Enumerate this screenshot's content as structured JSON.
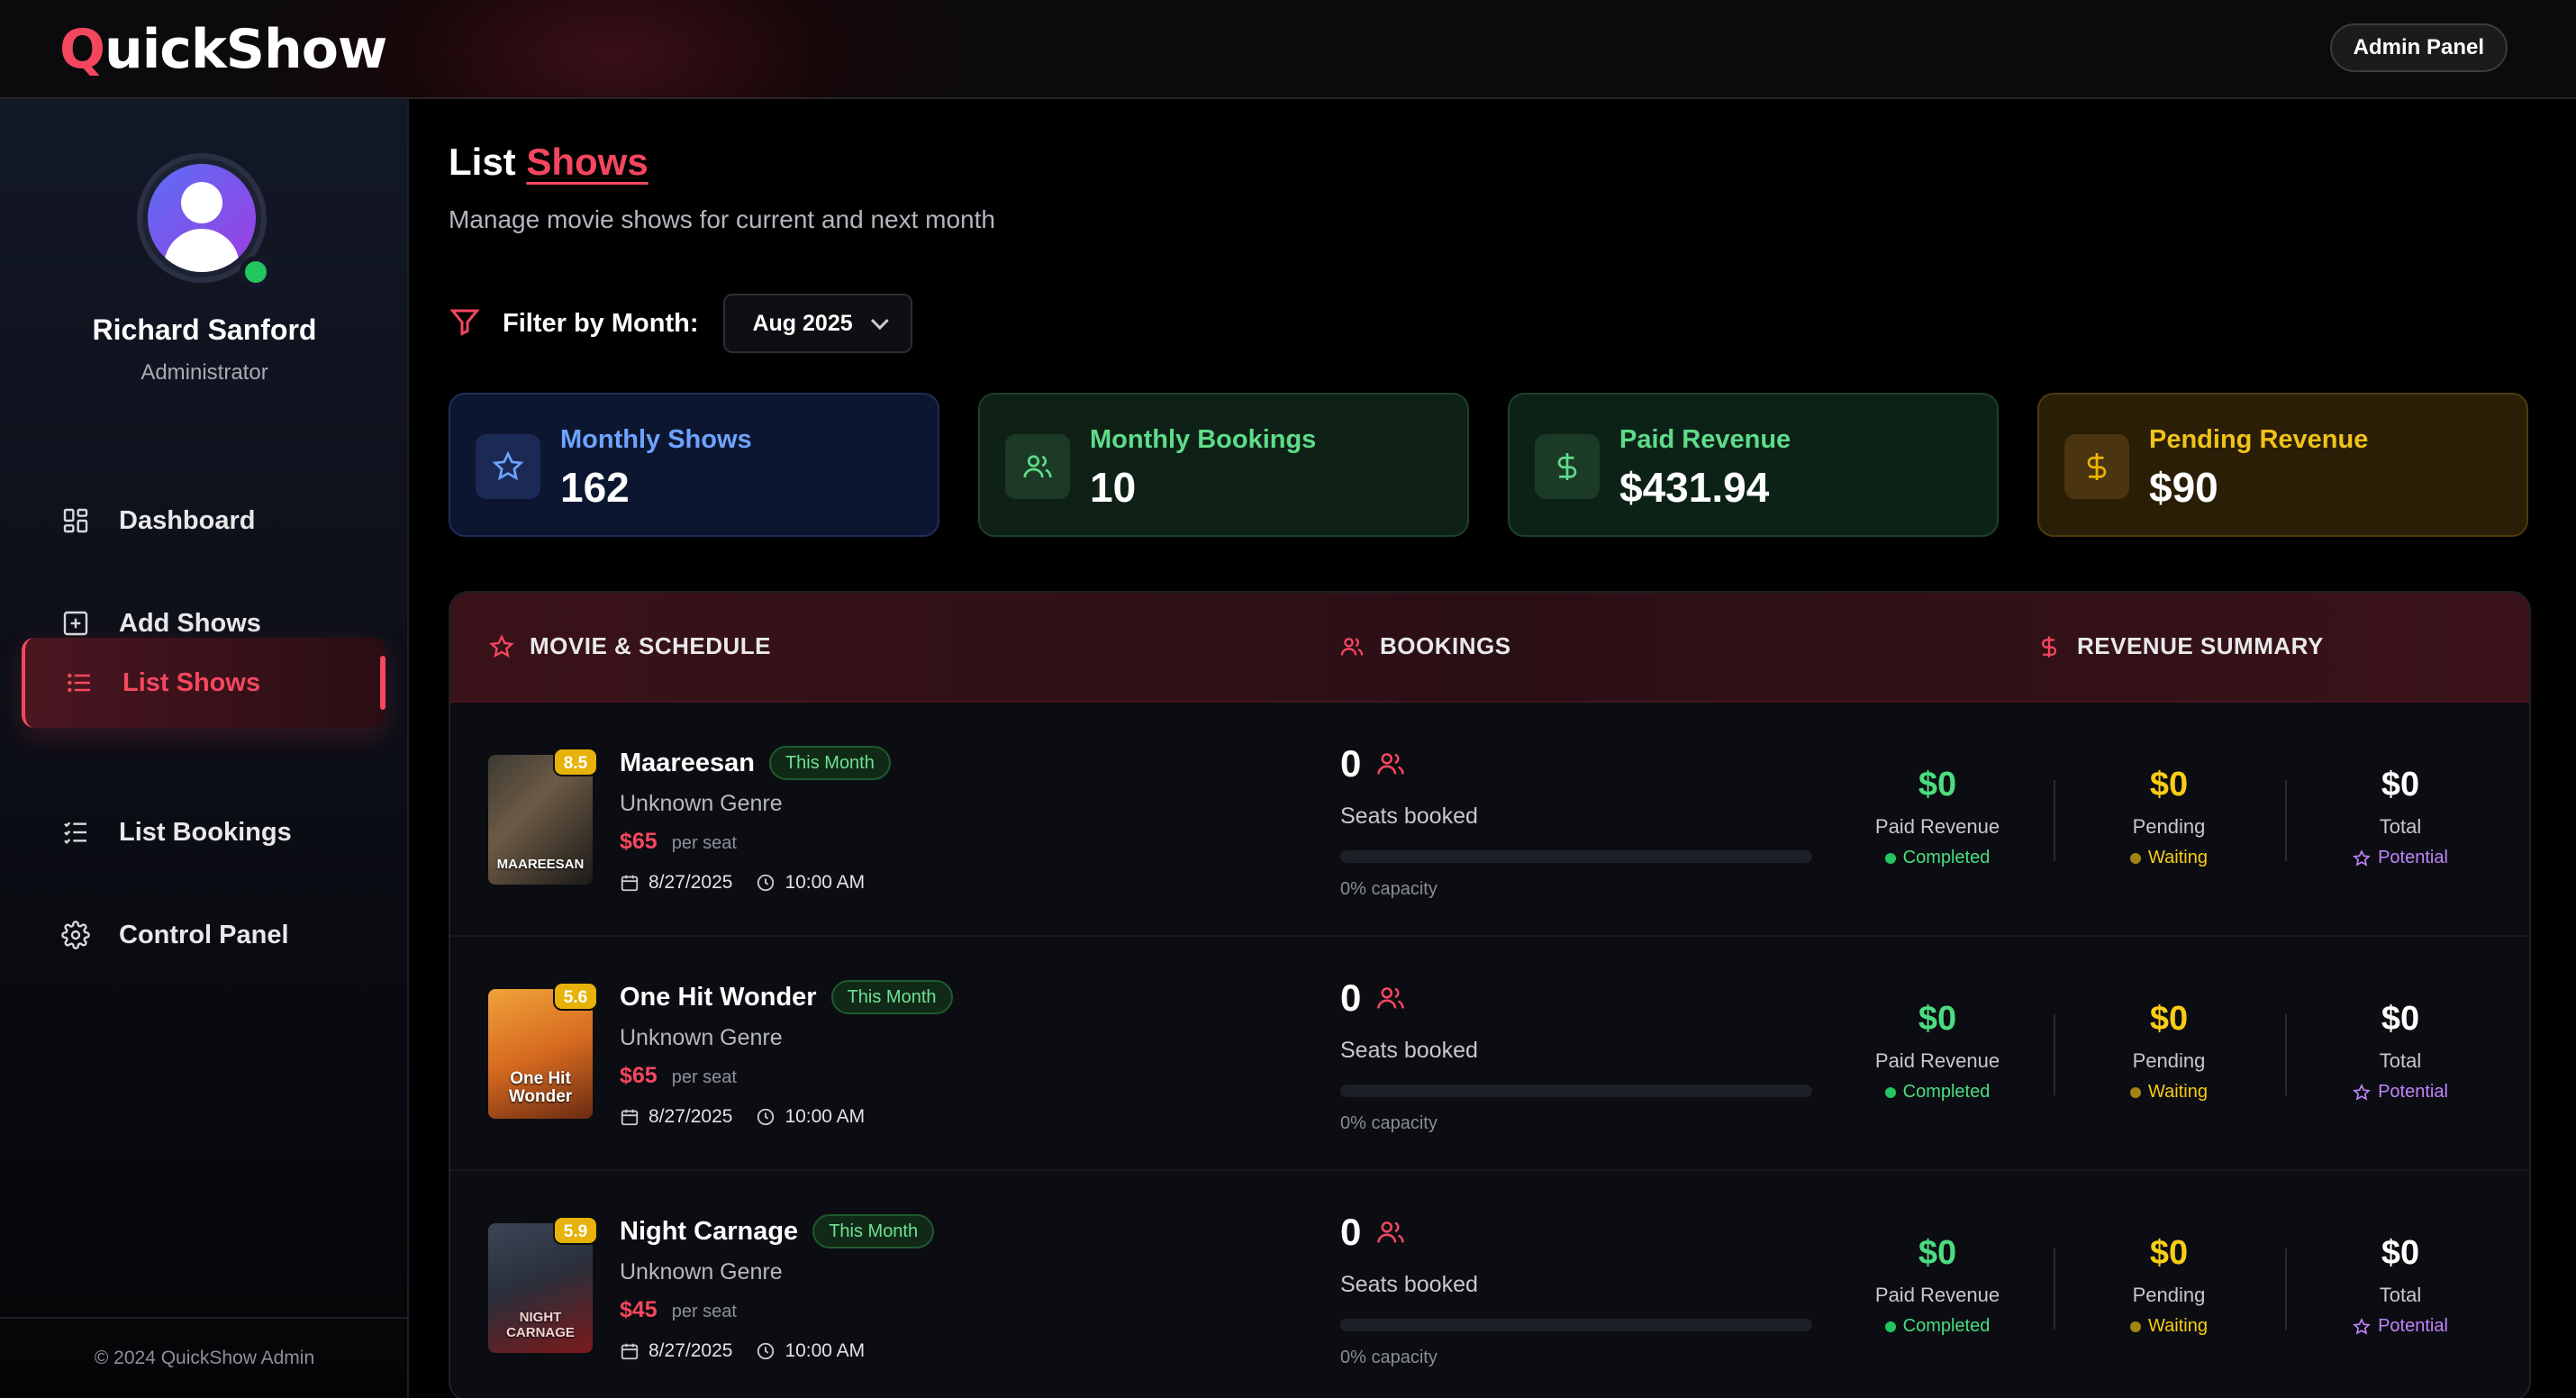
{
  "app": {
    "logo_first": "Q",
    "logo_rest": "uickShow",
    "admin_button": "Admin Panel"
  },
  "user": {
    "name": "Richard Sanford",
    "role": "Administrator"
  },
  "sidebar": {
    "items": [
      {
        "label": "Dashboard",
        "icon": "dashboard-grid-icon"
      },
      {
        "label": "Add Shows",
        "icon": "plus-square-icon"
      },
      {
        "label": "List Shows",
        "icon": "list-icon",
        "active": true
      },
      {
        "label": "List Bookings",
        "icon": "checklist-icon"
      },
      {
        "label": "Control Panel",
        "icon": "gear-icon"
      }
    ],
    "footer": "© 2024 QuickShow Admin"
  },
  "page": {
    "title_plain": "List",
    "title_accent": "Shows",
    "subtitle": "Manage movie shows for current and next month"
  },
  "filter": {
    "label": "Filter by Month:",
    "selected": "Aug 2025"
  },
  "stats": [
    {
      "label": "Monthly Shows",
      "value": "162",
      "icon": "star-icon"
    },
    {
      "label": "Monthly Bookings",
      "value": "10",
      "icon": "users-icon"
    },
    {
      "label": "Paid Revenue",
      "value": "$431.94",
      "icon": "dollar-icon"
    },
    {
      "label": "Pending Revenue",
      "value": "$90",
      "icon": "dollar-icon"
    }
  ],
  "table": {
    "headers": [
      "MOVIE & SCHEDULE",
      "BOOKINGS",
      "REVENUE SUMMARY"
    ],
    "rows": [
      {
        "title": "Maareesan",
        "badge": "This Month",
        "rating": "8.5",
        "poster_text": "MAAREESAN",
        "genre": "Unknown Genre",
        "price": "$65",
        "per": "per seat",
        "date": "8/27/2025",
        "time": "10:00 AM",
        "booked": "0",
        "booked_label": "Seats booked",
        "capacity": "0% capacity",
        "capacity_fraction": 0,
        "paid": "$0",
        "paid_label": "Paid Revenue",
        "paid_status": "Completed",
        "pending": "$0",
        "pending_label": "Pending",
        "pending_status": "Waiting",
        "total": "$0",
        "total_label": "Total",
        "total_status": "Potential"
      },
      {
        "title": "One Hit Wonder",
        "badge": "This Month",
        "rating": "5.6",
        "poster_text": "One Hit Wonder",
        "genre": "Unknown Genre",
        "price": "$65",
        "per": "per seat",
        "date": "8/27/2025",
        "time": "10:00 AM",
        "booked": "0",
        "booked_label": "Seats booked",
        "capacity": "0% capacity",
        "capacity_fraction": 0,
        "paid": "$0",
        "paid_label": "Paid Revenue",
        "paid_status": "Completed",
        "pending": "$0",
        "pending_label": "Pending",
        "pending_status": "Waiting",
        "total": "$0",
        "total_label": "Total",
        "total_status": "Potential"
      },
      {
        "title": "Night Carnage",
        "badge": "This Month",
        "rating": "5.9",
        "poster_text": "NIGHT CARNAGE",
        "genre": "Unknown Genre",
        "price": "$45",
        "per": "per seat",
        "date": "8/27/2025",
        "time": "10:00 AM",
        "booked": "0",
        "booked_label": "Seats booked",
        "capacity": "0% capacity",
        "capacity_fraction": 0,
        "paid": "$0",
        "paid_label": "Paid Revenue",
        "paid_status": "Completed",
        "pending": "$0",
        "pending_label": "Pending",
        "pending_status": "Waiting",
        "total": "$0",
        "total_label": "Total",
        "total_status": "Potential"
      }
    ]
  },
  "colors": {
    "accent": "#f4475f",
    "green": "#4ade80",
    "yellow": "#facc15",
    "purple": "#c084fc",
    "blue": "#6ea3ff"
  }
}
